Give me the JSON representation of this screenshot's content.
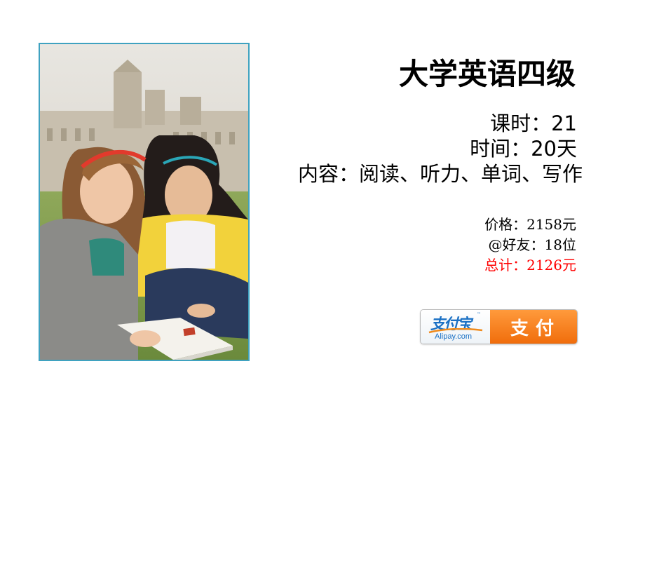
{
  "course": {
    "title": "大学英语四级",
    "hours": "课时：21",
    "duration": "时间：20天",
    "content": "内容：阅读、听力、单词、写作"
  },
  "pricing": {
    "price": "价格：2158元",
    "friends": "@好友：18位",
    "total": "总计：2126元"
  },
  "payment": {
    "logo_cn": "支付宝",
    "logo_en": "Alipay.com",
    "logo_tm": "™",
    "button_label": "支付"
  },
  "colors": {
    "frame_border": "#3fa2c0",
    "total_text": "#ff0000",
    "alipay_blue": "#1a70c4",
    "pay_orange": "#f06d0c"
  },
  "icons": {
    "photo": "course-photo-two-students-reading",
    "alipay": "alipay-logo"
  }
}
